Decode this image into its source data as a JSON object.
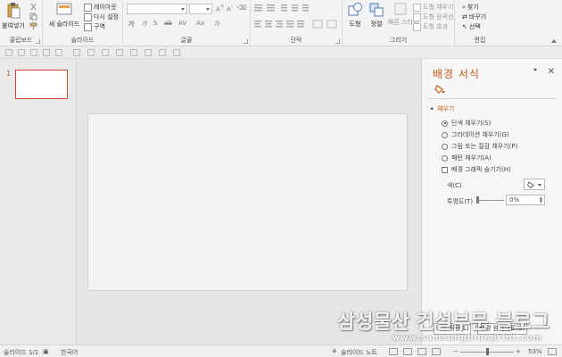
{
  "ribbon": {
    "clipboard": {
      "label": "클립보드",
      "paste": "붙여넣기"
    },
    "slides": {
      "label": "슬라이드",
      "new_slide": "새 슬라이드",
      "layout": "레이아웃",
      "reset": "다시 설정",
      "section": "구역"
    },
    "font": {
      "label": "글꼴",
      "format_marks": [
        "가",
        "가",
        "S",
        "ab",
        "AV",
        "Aa",
        "가"
      ]
    },
    "paragraph": {
      "label": "단락"
    },
    "drawing": {
      "label": "그리기",
      "shapes": "도형",
      "arrange": "정렬",
      "quick_styles": "빠른 스타일",
      "shape_fill": "도형 채우기",
      "shape_outline": "도형 윤곽선",
      "shape_effects": "도형 효과"
    },
    "editing": {
      "label": "편집",
      "find": "찾기",
      "replace": "바꾸기",
      "select": "선택"
    }
  },
  "thumbnails": {
    "slide_number": "1"
  },
  "pane": {
    "title": "배경 서식",
    "section": "채우기",
    "options": [
      "단색 채우기(S)",
      "그라데이션 채우기(G)",
      "그림 또는 질감 채우기(P)",
      "패턴 채우기(A)"
    ],
    "hide_graphics": "배경 그래픽 숨기기(H)",
    "color_label": "색(C)",
    "transparency_label": "투명도(T)",
    "transparency_value": "0%",
    "apply_all": "모두 적용(L)",
    "reset_bg": "배경 원래대로(B)"
  },
  "status": {
    "slide_info": "슬라이드 1/1",
    "language": "한국어",
    "notes": "슬라이드 노트",
    "zoom_minus": "−",
    "zoom_plus": "+",
    "zoom": "53%"
  },
  "watermark": {
    "title": "삼성물산 건설부문 블로그",
    "url": "www.samsungblueprint.com"
  },
  "colors": {
    "accent": "#c55a11",
    "selection": "#d24726"
  }
}
